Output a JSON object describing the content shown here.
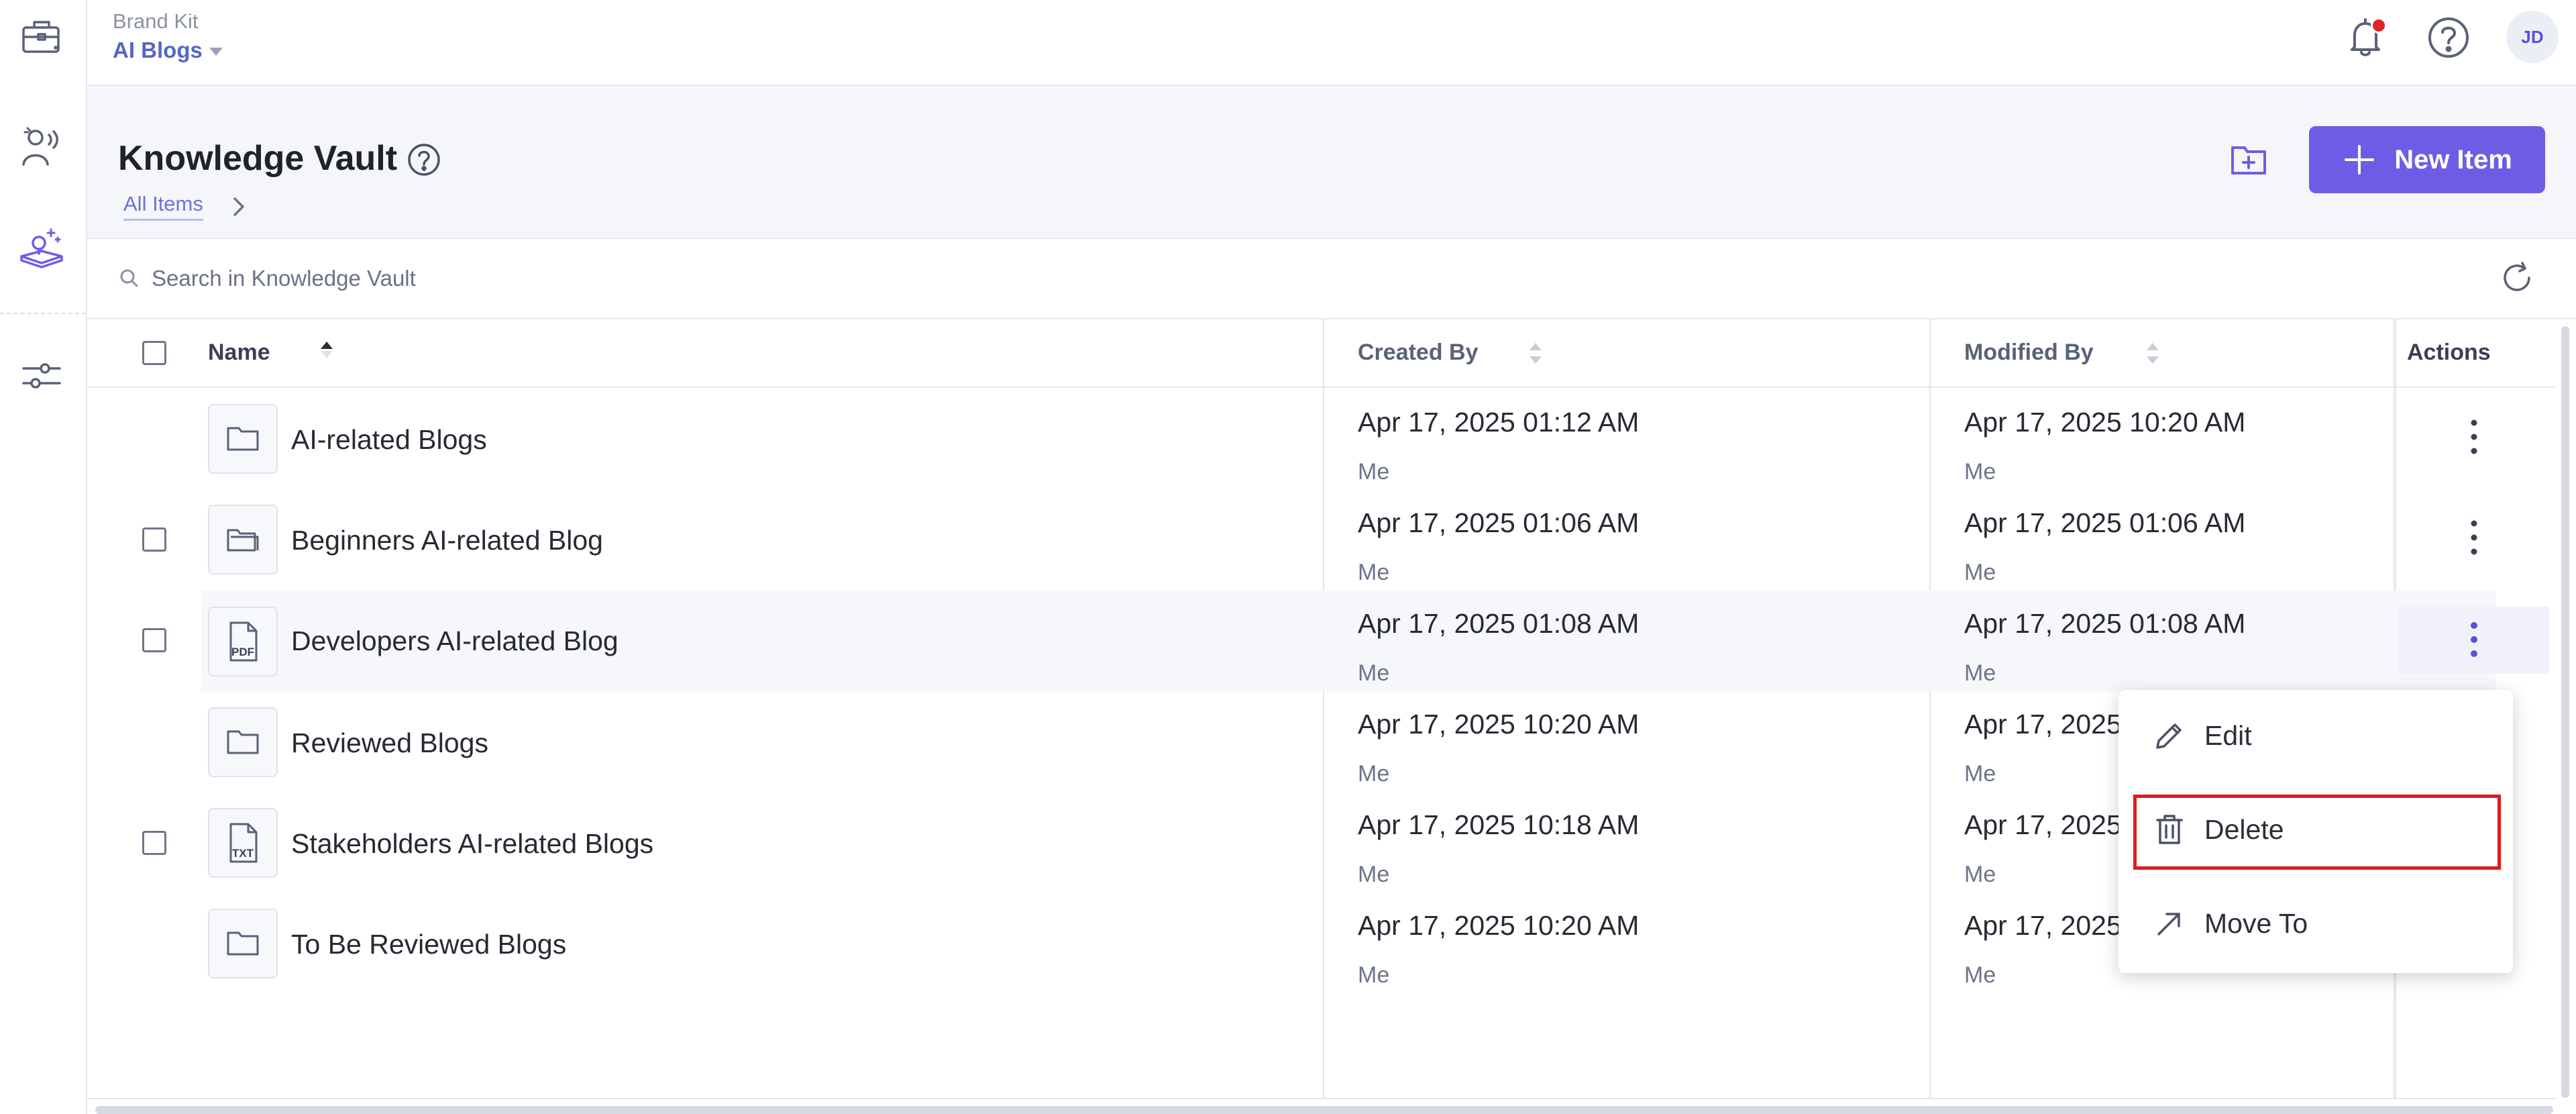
{
  "topbar": {
    "brand_kit_label": "Brand Kit",
    "workspace_name": "AI Blogs",
    "avatar_initials": "JD",
    "notification_dot_color": "#e02424"
  },
  "rail": {
    "icons": [
      "briefcase-icon",
      "voice-persona-icon",
      "knowledge-vault-icon",
      "sliders-icon"
    ],
    "active_icon": "knowledge-vault-icon",
    "active_color": "#6f5ce6"
  },
  "header": {
    "title": "Knowledge Vault",
    "breadcrumb": "All Items",
    "new_item_label": "New Item",
    "accent_color": "#6f5ce6"
  },
  "search": {
    "placeholder": "Search in Knowledge Vault"
  },
  "table": {
    "columns": {
      "name": "Name",
      "created": "Created By",
      "modified": "Modified By",
      "actions": "Actions"
    },
    "sort": {
      "column": "Name",
      "direction": "ascending"
    },
    "rows": [
      {
        "name": "AI-related Blogs",
        "icon": "folder-icon",
        "created_date": "Apr 17, 2025 01:12 AM",
        "created_by": "Me",
        "modified_date": "Apr 17, 2025 10:20 AM",
        "modified_by": "Me",
        "checkbox": false
      },
      {
        "name": "Beginners AI-related Blog",
        "icon": "folder-open-icon",
        "created_date": "Apr 17, 2025 01:06 AM",
        "created_by": "Me",
        "modified_date": "Apr 17, 2025 01:06 AM",
        "modified_by": "Me",
        "checkbox": true
      },
      {
        "name": "Developers AI-related Blog",
        "icon": "pdf-file-icon",
        "file_badge": "PDF",
        "created_date": "Apr 17, 2025 01:08 AM",
        "created_by": "Me",
        "modified_date": "Apr 17, 2025 01:08 AM",
        "modified_by": "Me",
        "checkbox": true,
        "highlighted": true
      },
      {
        "name": "Reviewed Blogs",
        "icon": "folder-icon",
        "created_date": "Apr 17, 2025 10:20 AM",
        "created_by": "Me",
        "modified_date": "Apr 17, 2025",
        "modified_by": "Me",
        "checkbox": false
      },
      {
        "name": "Stakeholders AI-related Blogs",
        "icon": "txt-file-icon",
        "file_badge": "TXT",
        "created_date": "Apr 17, 2025 10:18 AM",
        "created_by": "Me",
        "modified_date": "Apr 17, 2025",
        "modified_by": "Me",
        "checkbox": true
      },
      {
        "name": "To Be Reviewed Blogs",
        "icon": "folder-icon",
        "created_date": "Apr 17, 2025 10:20 AM",
        "created_by": "Me",
        "modified_date": "Apr 17, 2025",
        "modified_by": "Me",
        "checkbox": false
      }
    ]
  },
  "context_menu": {
    "items": [
      {
        "label": "Edit",
        "icon": "pencil-icon"
      },
      {
        "label": "Delete",
        "icon": "trash-icon",
        "highlighted": true
      },
      {
        "label": "Move To",
        "icon": "arrow-up-right-icon"
      }
    ],
    "highlight_color": "#e01b1b"
  }
}
